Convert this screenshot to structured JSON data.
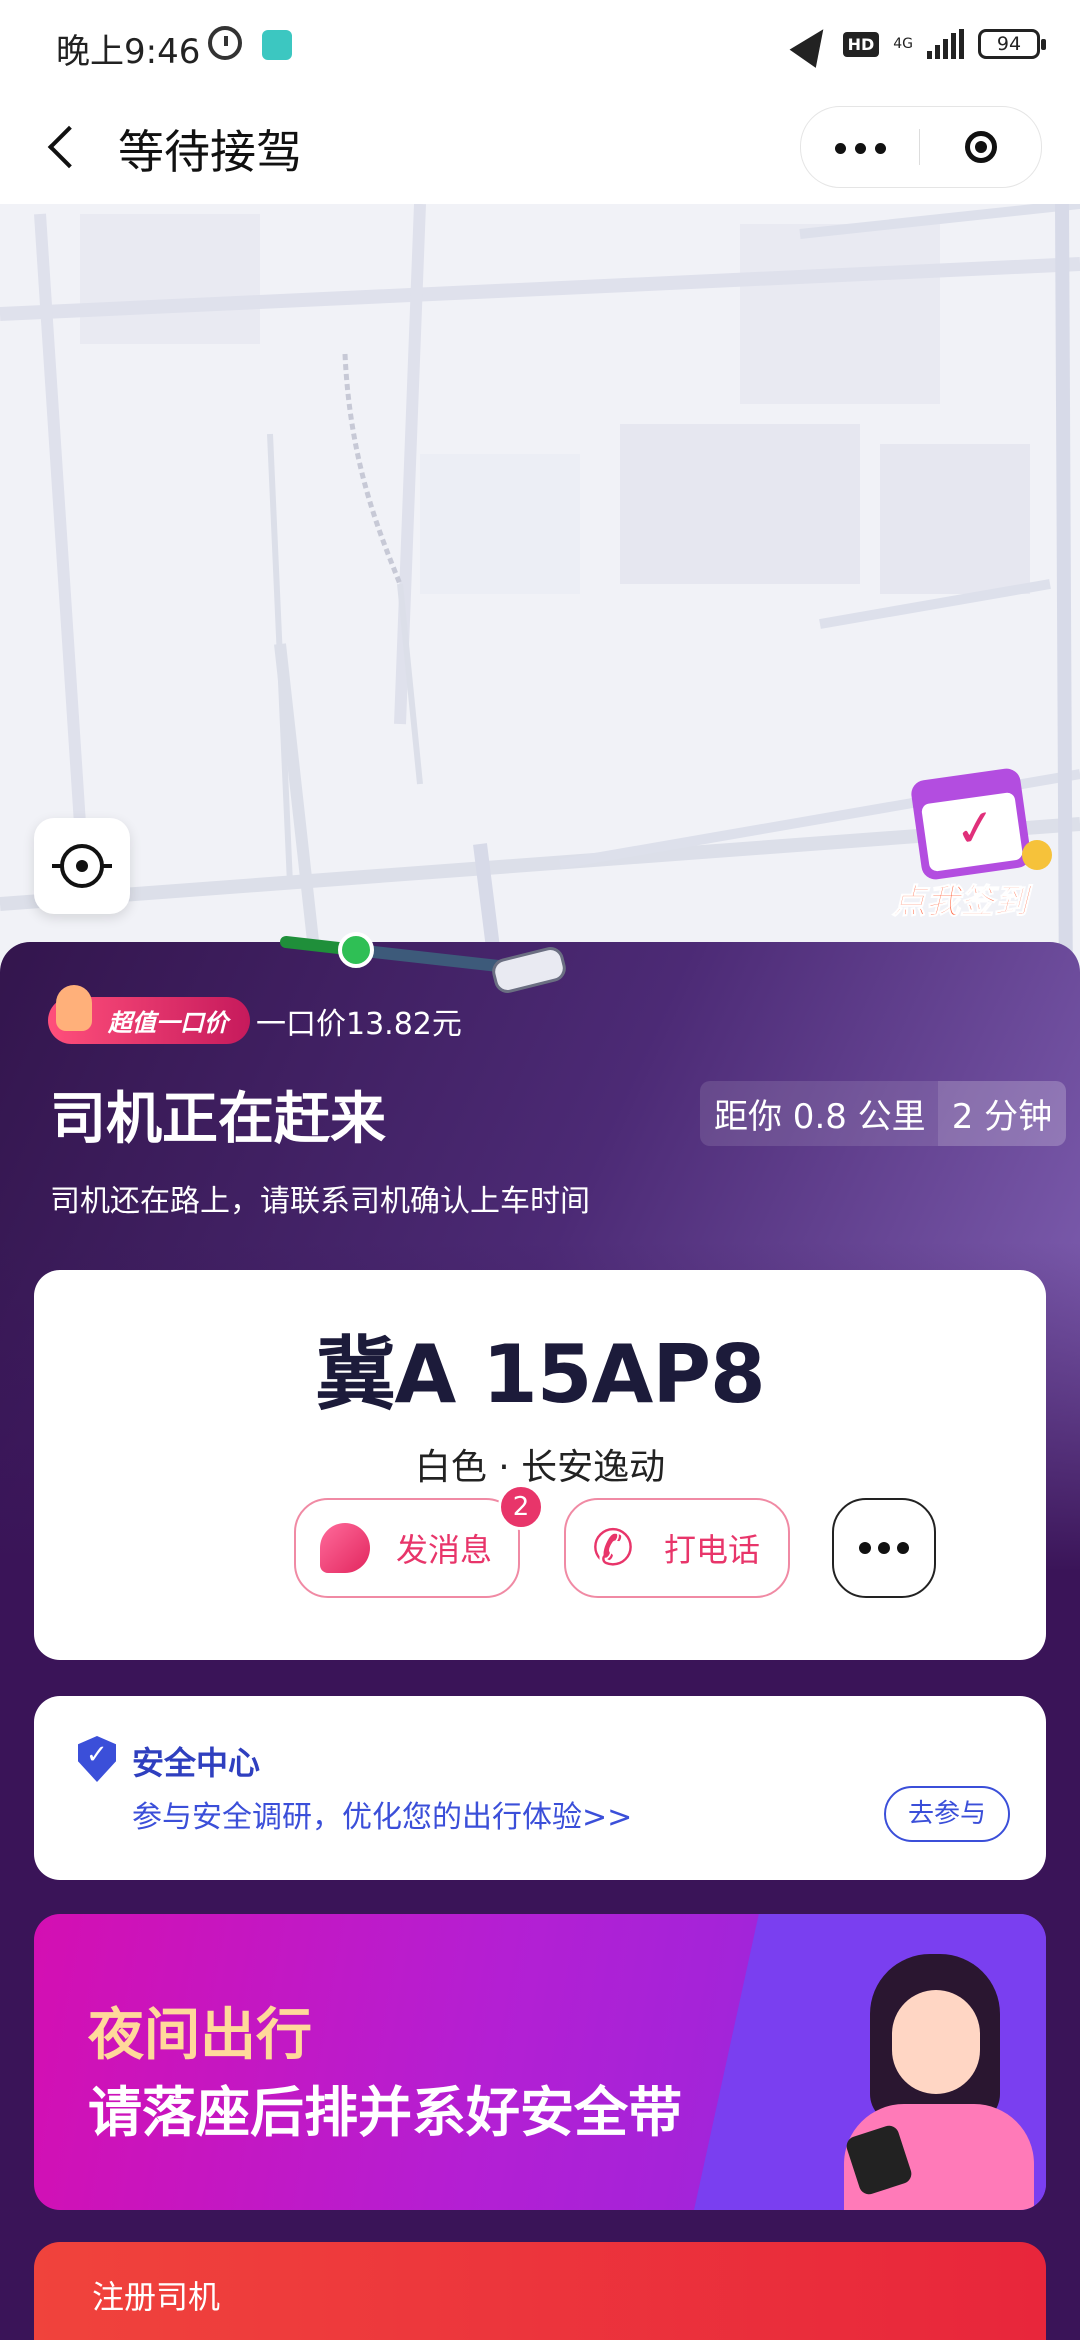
{
  "status_bar": {
    "time": "晚上9:46",
    "hd": "HD",
    "network": "4G",
    "battery": "94"
  },
  "header": {
    "title": "等待接驾"
  },
  "map": {
    "checkin_label": "点我签到"
  },
  "trip": {
    "price_badge": "超值一口价",
    "price_text": "一口价13.82元",
    "headline": "司机正在赶来",
    "distance": "距你 0.8 公里",
    "eta": "2 分钟",
    "subline": "司机还在路上，请联系司机确认上车时间"
  },
  "car": {
    "plate": "冀A 15AP8",
    "description": "白色 · 长安逸动"
  },
  "actions": {
    "message_label": "发消息",
    "message_badge": "2",
    "call_label": "打电话"
  },
  "safety": {
    "title": "安全中心",
    "description": "参与安全调研，优化您的出行体验>>",
    "button": "去参与"
  },
  "banner": {
    "line1": "夜间出行",
    "line2": "请落座后排并系好安全带"
  },
  "driver_promo": {
    "label": "注册司机"
  },
  "icons": [
    "alarm-icon",
    "location-arrow-icon",
    "signal-icon",
    "battery-icon",
    "back-arrow-icon",
    "more-dots-icon",
    "close-circle-icon",
    "crosshair-icon",
    "calendar-icon",
    "hand-icon",
    "chat-icon",
    "phone-icon",
    "shield-icon"
  ]
}
